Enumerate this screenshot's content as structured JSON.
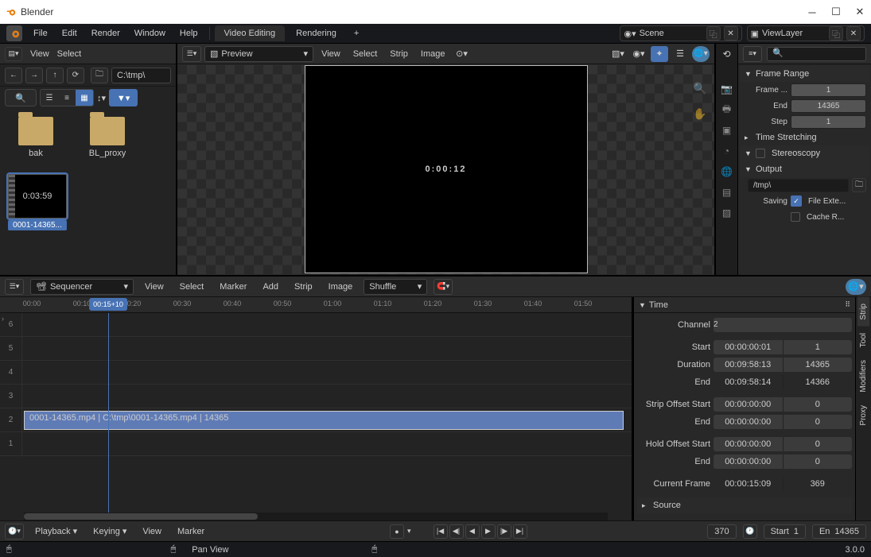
{
  "window": {
    "title": "Blender"
  },
  "top_menu": {
    "items": [
      "File",
      "Edit",
      "Render",
      "Window",
      "Help"
    ],
    "workspace_tabs": [
      "Video Editing",
      "Rendering"
    ],
    "active_workspace": "Video Editing",
    "scene": "Scene",
    "view_layer": "ViewLayer"
  },
  "file_browser": {
    "menu": [
      "View",
      "Select"
    ],
    "path": "C:\\tmp\\",
    "folders": [
      {
        "name": "bak"
      },
      {
        "name": "BL_proxy"
      }
    ],
    "files": [
      {
        "name": "0001-14365...",
        "thumb_text": "0:03:59",
        "selected": true
      }
    ]
  },
  "preview": {
    "mode": "Preview",
    "menu": [
      "View",
      "Select",
      "Strip",
      "Image"
    ],
    "canvas_text": "0:00:12"
  },
  "properties": {
    "frame_range_title": "Frame Range",
    "frame_start_label": "Frame ...",
    "frame_start": "1",
    "end_label": "End",
    "end": "14365",
    "step_label": "Step",
    "step": "1",
    "time_stretching": "Time Stretching",
    "stereoscopy": "Stereoscopy",
    "output": "Output",
    "output_path": "/tmp\\",
    "saving": "Saving",
    "file_ext": "File Exte...",
    "cache": "Cache R..."
  },
  "sequencer": {
    "mode": "Sequencer",
    "menu": [
      "View",
      "Select",
      "Marker",
      "Add",
      "Strip",
      "Image"
    ],
    "overlap_mode": "Shuffle",
    "ruler_ticks": [
      "00:00",
      "00:10",
      "00:20",
      "00:30",
      "00:40",
      "00:50",
      "01:00",
      "01:10",
      "01:20",
      "01:30",
      "01:40",
      "01:50"
    ],
    "playhead_label": "00:15+10",
    "channels": [
      6,
      5,
      4,
      3,
      2,
      1
    ],
    "strip_label": "0001-14365.mp4 | C:\\tmp\\0001-14365.mp4 | 14365"
  },
  "strip_props": {
    "time_title": "Time",
    "channel_label": "Channel",
    "channel": "2",
    "start_label": "Start",
    "start_tc": "00:00:00:01",
    "start_f": "1",
    "duration_label": "Duration",
    "duration_tc": "00:09:58:13",
    "duration_f": "14365",
    "end_label": "End",
    "end_tc": "00:09:58:14",
    "end_f": "14366",
    "sos_label": "Strip Offset Start",
    "sos_tc": "00:00:00:00",
    "sos_f": "0",
    "soe_label": "End",
    "soe_tc": "00:00:00:00",
    "soe_f": "0",
    "hos_label": "Hold Offset Start",
    "hos_tc": "00:00:00:00",
    "hos_f": "0",
    "hoe_label": "End",
    "hoe_tc": "00:00:00:00",
    "hoe_f": "0",
    "cf_label": "Current Frame",
    "cf_tc": "00:00:15:09",
    "cf_f": "369",
    "source_title": "Source",
    "vtabs": [
      "Strip",
      "Tool",
      "Modifiers",
      "Proxy"
    ]
  },
  "playbar": {
    "playback": "Playback",
    "keying": "Keying",
    "view": "View",
    "marker": "Marker",
    "current": "370",
    "start_label": "Start",
    "start": "1",
    "end_label": "En",
    "end": "14365"
  },
  "status": {
    "hint": "Pan View",
    "version": "3.0.0"
  }
}
